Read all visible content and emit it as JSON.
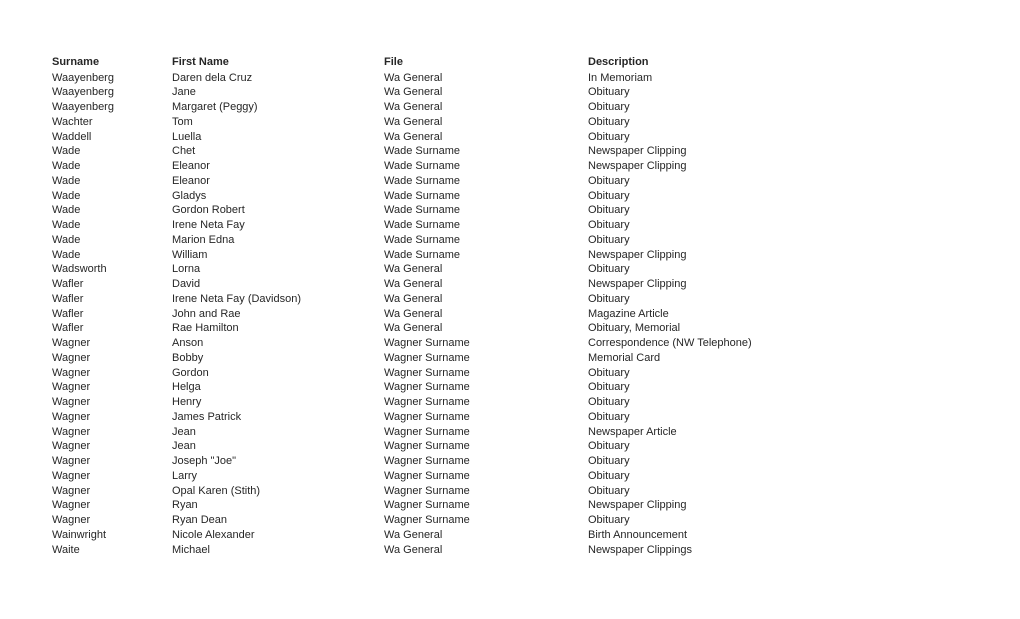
{
  "document": {
    "text_color": "#262626",
    "background_color": "#ffffff"
  },
  "table": {
    "columns": [
      {
        "key": "surname",
        "label": "Surname"
      },
      {
        "key": "first_name",
        "label": "First Name"
      },
      {
        "key": "file",
        "label": "File"
      },
      {
        "key": "description",
        "label": "Description"
      }
    ],
    "rows": [
      {
        "surname": "Waayenberg",
        "first_name": "Daren dela Cruz",
        "file": "Wa General",
        "description": "In Memoriam"
      },
      {
        "surname": "Waayenberg",
        "first_name": "Jane",
        "file": "Wa General",
        "description": "Obituary"
      },
      {
        "surname": "Waayenberg",
        "first_name": "Margaret (Peggy)",
        "file": "Wa General",
        "description": "Obituary"
      },
      {
        "surname": "Wachter",
        "first_name": "Tom",
        "file": "Wa General",
        "description": "Obituary"
      },
      {
        "surname": "Waddell",
        "first_name": "Luella",
        "file": "Wa General",
        "description": "Obituary"
      },
      {
        "surname": "Wade",
        "first_name": "Chet",
        "file": "Wade Surname",
        "description": "Newspaper Clipping"
      },
      {
        "surname": "Wade",
        "first_name": "Eleanor",
        "file": "Wade Surname",
        "description": "Newspaper Clipping"
      },
      {
        "surname": "Wade",
        "first_name": "Eleanor",
        "file": "Wade Surname",
        "description": "Obituary"
      },
      {
        "surname": "Wade",
        "first_name": "Gladys",
        "file": "Wade Surname",
        "description": "Obituary"
      },
      {
        "surname": "Wade",
        "first_name": "Gordon Robert",
        "file": "Wade Surname",
        "description": "Obituary"
      },
      {
        "surname": "Wade",
        "first_name": "Irene Neta Fay",
        "file": "Wade Surname",
        "description": "Obituary"
      },
      {
        "surname": "Wade",
        "first_name": "Marion Edna",
        "file": "Wade Surname",
        "description": "Obituary"
      },
      {
        "surname": "Wade",
        "first_name": "William",
        "file": "Wade Surname",
        "description": "Newspaper Clipping"
      },
      {
        "surname": "Wadsworth",
        "first_name": "Lorna",
        "file": "Wa General",
        "description": "Obituary"
      },
      {
        "surname": "Wafler",
        "first_name": "David",
        "file": "Wa General",
        "description": "Newspaper Clipping"
      },
      {
        "surname": "Wafler",
        "first_name": "Irene Neta Fay (Davidson)",
        "file": "Wa General",
        "description": "Obituary"
      },
      {
        "surname": "Wafler",
        "first_name": "John and Rae",
        "file": "Wa General",
        "description": "Magazine Article"
      },
      {
        "surname": "Wafler",
        "first_name": "Rae Hamilton",
        "file": "Wa General",
        "description": "Obituary, Memorial"
      },
      {
        "surname": "Wagner",
        "first_name": "Anson",
        "file": "Wagner Surname",
        "description": "Correspondence (NW Telephone)"
      },
      {
        "surname": "Wagner",
        "first_name": "Bobby",
        "file": "Wagner Surname",
        "description": "Memorial Card"
      },
      {
        "surname": "Wagner",
        "first_name": "Gordon",
        "file": "Wagner Surname",
        "description": "Obituary"
      },
      {
        "surname": "Wagner",
        "first_name": "Helga",
        "file": "Wagner Surname",
        "description": "Obituary"
      },
      {
        "surname": "Wagner",
        "first_name": "Henry",
        "file": "Wagner Surname",
        "description": "Obituary"
      },
      {
        "surname": "Wagner",
        "first_name": "James Patrick",
        "file": "Wagner Surname",
        "description": "Obituary"
      },
      {
        "surname": "Wagner",
        "first_name": "Jean",
        "file": "Wagner Surname",
        "description": "Newspaper Article"
      },
      {
        "surname": "Wagner",
        "first_name": "Jean",
        "file": "Wagner Surname",
        "description": "Obituary"
      },
      {
        "surname": "Wagner",
        "first_name": "Joseph \"Joe\"",
        "file": "Wagner Surname",
        "description": "Obituary"
      },
      {
        "surname": "Wagner",
        "first_name": "Larry",
        "file": "Wagner Surname",
        "description": "Obituary"
      },
      {
        "surname": "Wagner",
        "first_name": "Opal Karen (Stith)",
        "file": "Wagner Surname",
        "description": "Obituary"
      },
      {
        "surname": "Wagner",
        "first_name": "Ryan",
        "file": "Wagner Surname",
        "description": "Newspaper Clipping"
      },
      {
        "surname": "Wagner",
        "first_name": "Ryan Dean",
        "file": "Wagner Surname",
        "description": "Obituary"
      },
      {
        "surname": "Wainwright",
        "first_name": "Nicole Alexander",
        "file": "Wa General",
        "description": "Birth Announcement"
      },
      {
        "surname": "Waite",
        "first_name": "Michael",
        "file": "Wa General",
        "description": "Newspaper Clippings"
      }
    ]
  }
}
